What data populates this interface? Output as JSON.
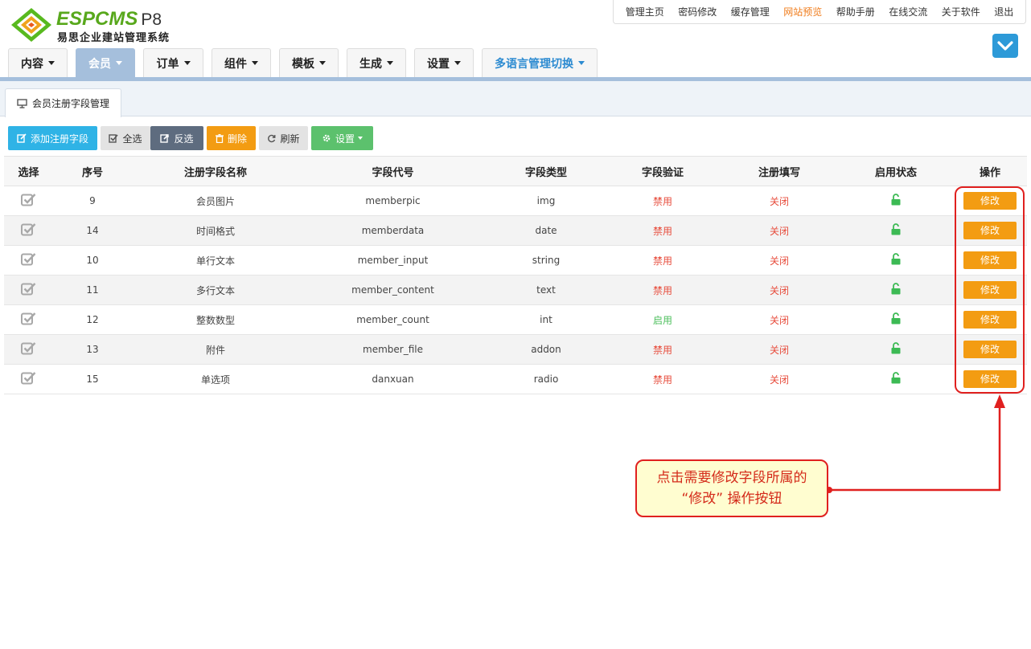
{
  "brand": {
    "logo_text": "ESPCMS",
    "version": "P8",
    "subtitle": "易思企业建站管理系统"
  },
  "top_links": [
    {
      "label": "管理主页"
    },
    {
      "label": "密码修改"
    },
    {
      "label": "缓存管理"
    },
    {
      "label": "网站预览",
      "highlight": true
    },
    {
      "label": "帮助手册"
    },
    {
      "label": "在线交流"
    },
    {
      "label": "关于软件"
    },
    {
      "label": "退出"
    }
  ],
  "main_nav": [
    {
      "label": "内容"
    },
    {
      "label": "会员",
      "active": true
    },
    {
      "label": "订单"
    },
    {
      "label": "组件"
    },
    {
      "label": "模板"
    },
    {
      "label": "生成"
    },
    {
      "label": "设置"
    },
    {
      "label": "多语言管理切换"
    }
  ],
  "sub_tab": {
    "label": "会员注册字段管理"
  },
  "toolbar": {
    "add": "添加注册字段",
    "select_all": "全选",
    "invert": "反选",
    "delete": "删除",
    "refresh": "刷新",
    "settings": "设置"
  },
  "table": {
    "columns": [
      "选择",
      "序号",
      "注册字段名称",
      "字段代号",
      "字段类型",
      "字段验证",
      "注册填写",
      "启用状态",
      "操作"
    ],
    "rows": [
      {
        "id": "9",
        "name": "会员图片",
        "code": "memberpic",
        "type": "img",
        "validate": "禁用",
        "required": "关闭",
        "action": "修改"
      },
      {
        "id": "14",
        "name": "时间格式",
        "code": "memberdata",
        "type": "date",
        "validate": "禁用",
        "required": "关闭",
        "action": "修改"
      },
      {
        "id": "10",
        "name": "单行文本",
        "code": "member_input",
        "type": "string",
        "validate": "禁用",
        "required": "关闭",
        "action": "修改"
      },
      {
        "id": "11",
        "name": "多行文本",
        "code": "member_content",
        "type": "text",
        "validate": "禁用",
        "required": "关闭",
        "action": "修改"
      },
      {
        "id": "12",
        "name": "整数数型",
        "code": "member_count",
        "type": "int",
        "validate": "启用",
        "required": "关闭",
        "action": "修改"
      },
      {
        "id": "13",
        "name": "附件",
        "code": "member_file",
        "type": "addon",
        "validate": "禁用",
        "required": "关闭",
        "action": "修改"
      },
      {
        "id": "15",
        "name": "单选项",
        "code": "danxuan",
        "type": "radio",
        "validate": "禁用",
        "required": "关闭",
        "action": "修改"
      }
    ]
  },
  "annotation": {
    "line1": "点击需要修改字段所属的",
    "line2": "“修改” 操作按钮"
  },
  "colors": {
    "accent_blue": "#2d9ad8",
    "nav_active": "#a5bfdc",
    "orange": "#f39c12",
    "highlight_link": "#f07c1b",
    "disabled_red": "#e74c3c",
    "enabled_green": "#4cbf5c",
    "annotation_red": "#e0201f"
  }
}
